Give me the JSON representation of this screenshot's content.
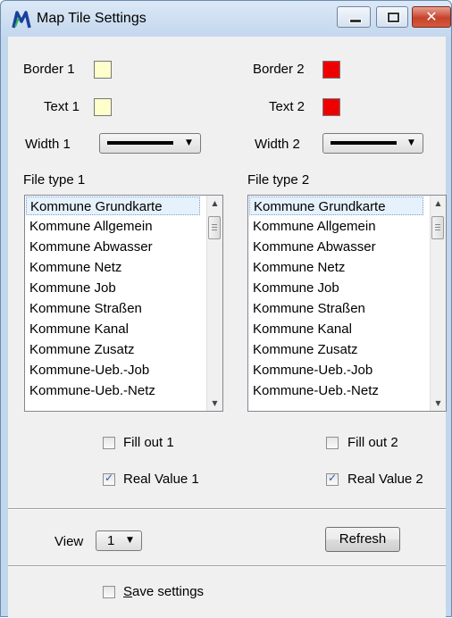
{
  "window": {
    "title": "Map Tile Settings",
    "close_glyph": "✕"
  },
  "colors": {
    "border1": "#ffffcc",
    "text1": "#ffffcc",
    "border2": "#ee0000",
    "text2": "#ee0000"
  },
  "left": {
    "border_label": "Border 1",
    "text_label": "Text 1",
    "width_label": "Width 1",
    "file_type_label": "File type 1",
    "fill_out_label": "Fill out 1",
    "fill_out_checked": false,
    "real_value_label": "Real Value 1",
    "real_value_checked": true
  },
  "right": {
    "border_label": "Border 2",
    "text_label": "Text 2",
    "width_label": "Width 2",
    "file_type_label": "File type 2",
    "fill_out_label": "Fill out 2",
    "fill_out_checked": false,
    "real_value_label": "Real Value 2",
    "real_value_checked": true
  },
  "file_types": [
    "Kommune Grundkarte",
    "Kommune Allgemein",
    "Kommune Abwasser",
    "Kommune Netz",
    "Kommune Job",
    "Kommune Straßen",
    "Kommune Kanal",
    "Kommune Zusatz",
    "Kommune-Ueb.-Job",
    "Kommune-Ueb.-Netz"
  ],
  "selected_index": 0,
  "view": {
    "label": "View",
    "value": "1"
  },
  "refresh_label": "Refresh",
  "save_settings": {
    "label_prefix": "S",
    "label_rest": "ave settings",
    "checked": false
  }
}
